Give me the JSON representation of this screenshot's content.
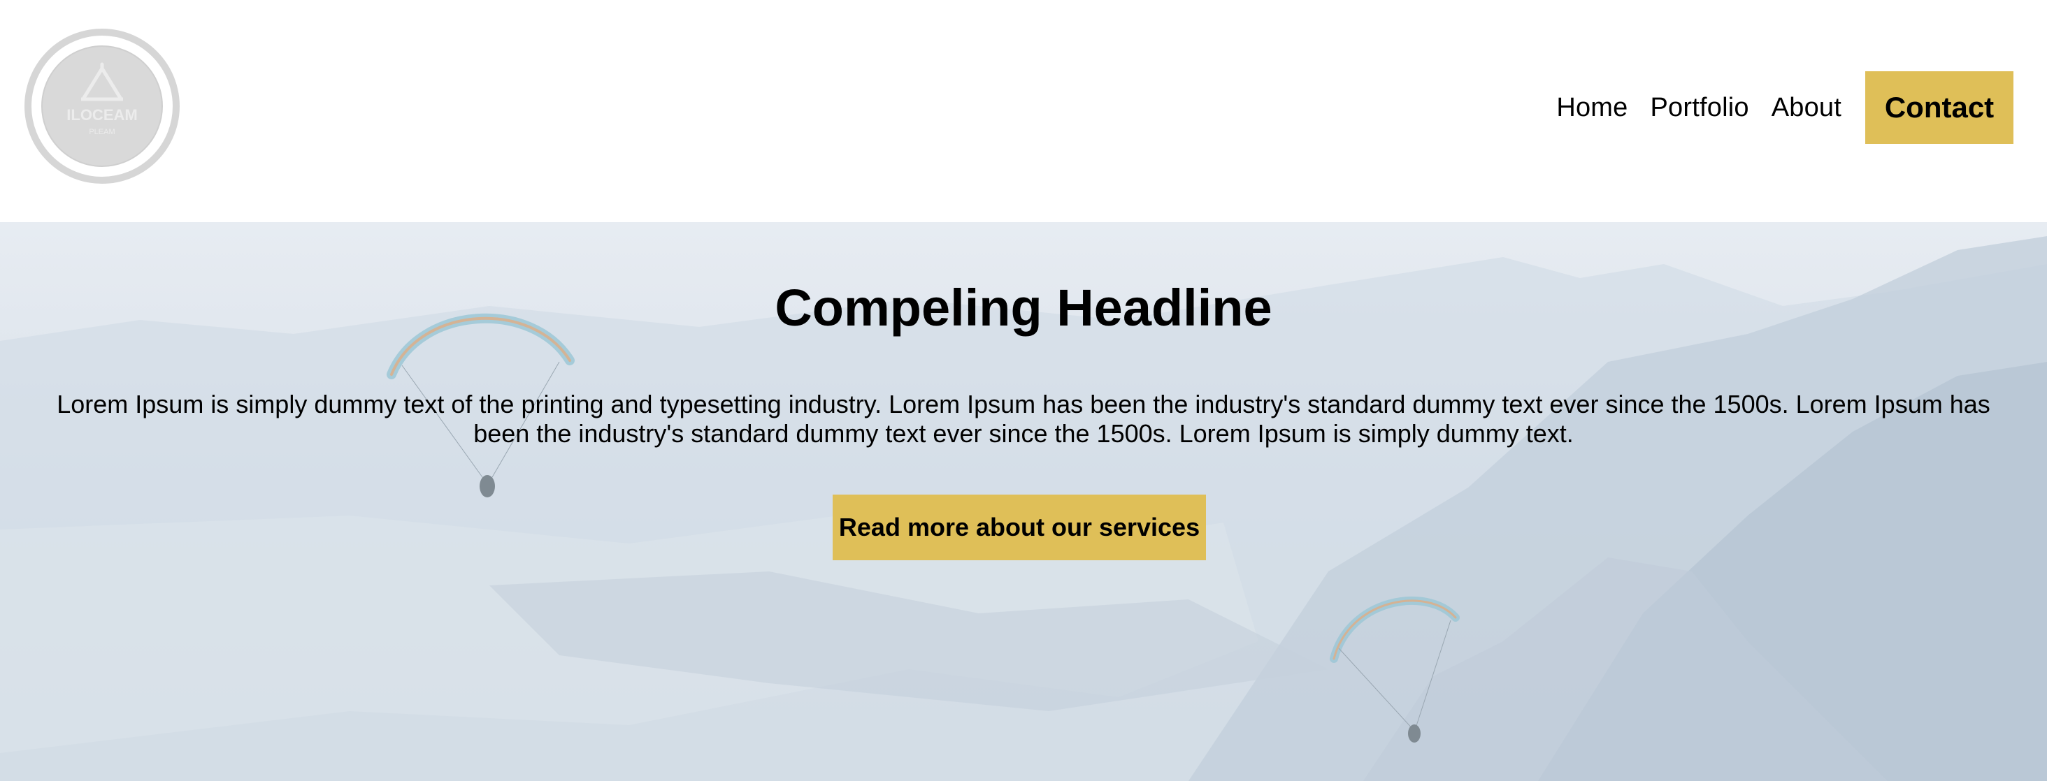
{
  "brand": {
    "logo_icon": "circular-logo-icon",
    "logo_text": "ILOCEAM",
    "logo_subtext": "PLEAM"
  },
  "nav": {
    "items": [
      {
        "label": "Home"
      },
      {
        "label": "Portfolio"
      },
      {
        "label": "About"
      }
    ],
    "contact_label": "Contact"
  },
  "hero": {
    "headline": "Compeling Headline",
    "body": "Lorem Ipsum is simply dummy text of the printing and typesetting industry. Lorem Ipsum has been the industry's standard dummy text ever since the 1500s. Lorem Ipsum has been the industry's standard dummy text ever since the 1500s. Lorem Ipsum is simply dummy text.",
    "cta_label": "Read more about our services",
    "background_icon": "paragliders-mountain-lake-image"
  },
  "colors": {
    "accent": "#dfbf58",
    "text": "#000000",
    "header_bg": "#ffffff"
  }
}
